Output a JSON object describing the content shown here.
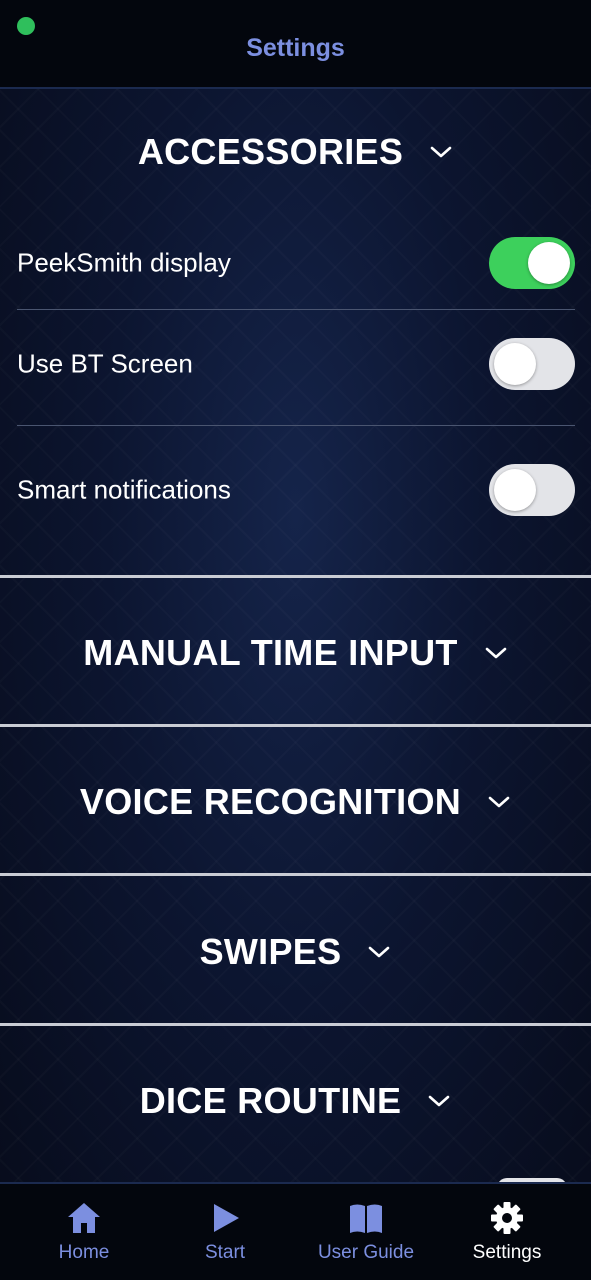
{
  "header": {
    "title": "Settings"
  },
  "sections": [
    {
      "title": "ACCESSORIES",
      "expanded": true,
      "settings": [
        {
          "label": "PeekSmith display",
          "on": true
        },
        {
          "label": "Use BT Screen",
          "on": false
        },
        {
          "label": "Smart notifications",
          "on": false
        }
      ]
    },
    {
      "title": "MANUAL TIME INPUT",
      "expanded": false
    },
    {
      "title": "VOICE RECOGNITION",
      "expanded": false
    },
    {
      "title": "SWIPES",
      "expanded": false
    },
    {
      "title": "DICE ROUTINE",
      "expanded": false
    }
  ],
  "nav": [
    {
      "label": "Home",
      "icon": "home-icon",
      "active": false
    },
    {
      "label": "Start",
      "icon": "play-icon",
      "active": false
    },
    {
      "label": "User Guide",
      "icon": "book-icon",
      "active": false
    },
    {
      "label": "Settings",
      "icon": "gear-icon",
      "active": true
    }
  ],
  "colors": {
    "accent": "#7c8fe0",
    "toggle_on": "#3dd05c",
    "toggle_off": "#e3e4e8",
    "status_dot": "#2fbf5c"
  }
}
